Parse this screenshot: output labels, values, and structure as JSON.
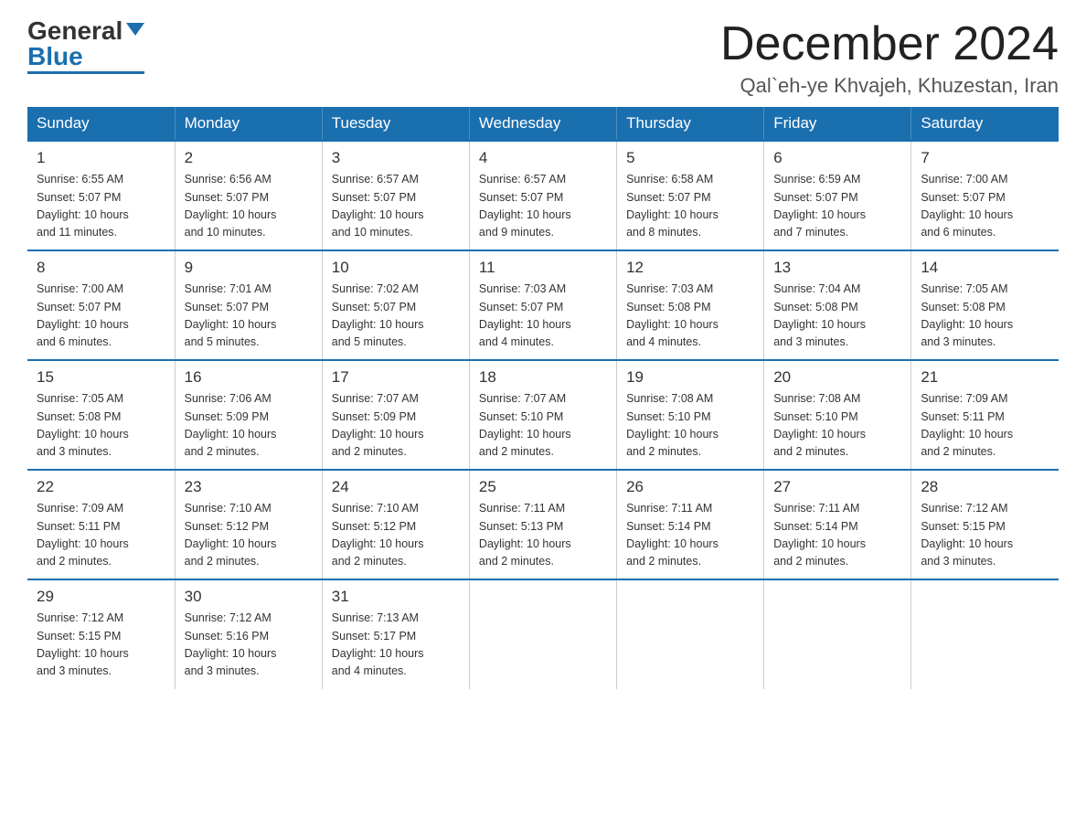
{
  "logo": {
    "general": "General",
    "blue": "Blue"
  },
  "header": {
    "month": "December 2024",
    "location": "Qal`eh-ye Khvajeh, Khuzestan, Iran"
  },
  "days_of_week": [
    "Sunday",
    "Monday",
    "Tuesday",
    "Wednesday",
    "Thursday",
    "Friday",
    "Saturday"
  ],
  "weeks": [
    [
      {
        "day": "1",
        "sunrise": "6:55 AM",
        "sunset": "5:07 PM",
        "daylight": "10 hours and 11 minutes."
      },
      {
        "day": "2",
        "sunrise": "6:56 AM",
        "sunset": "5:07 PM",
        "daylight": "10 hours and 10 minutes."
      },
      {
        "day": "3",
        "sunrise": "6:57 AM",
        "sunset": "5:07 PM",
        "daylight": "10 hours and 10 minutes."
      },
      {
        "day": "4",
        "sunrise": "6:57 AM",
        "sunset": "5:07 PM",
        "daylight": "10 hours and 9 minutes."
      },
      {
        "day": "5",
        "sunrise": "6:58 AM",
        "sunset": "5:07 PM",
        "daylight": "10 hours and 8 minutes."
      },
      {
        "day": "6",
        "sunrise": "6:59 AM",
        "sunset": "5:07 PM",
        "daylight": "10 hours and 7 minutes."
      },
      {
        "day": "7",
        "sunrise": "7:00 AM",
        "sunset": "5:07 PM",
        "daylight": "10 hours and 6 minutes."
      }
    ],
    [
      {
        "day": "8",
        "sunrise": "7:00 AM",
        "sunset": "5:07 PM",
        "daylight": "10 hours and 6 minutes."
      },
      {
        "day": "9",
        "sunrise": "7:01 AM",
        "sunset": "5:07 PM",
        "daylight": "10 hours and 5 minutes."
      },
      {
        "day": "10",
        "sunrise": "7:02 AM",
        "sunset": "5:07 PM",
        "daylight": "10 hours and 5 minutes."
      },
      {
        "day": "11",
        "sunrise": "7:03 AM",
        "sunset": "5:07 PM",
        "daylight": "10 hours and 4 minutes."
      },
      {
        "day": "12",
        "sunrise": "7:03 AM",
        "sunset": "5:08 PM",
        "daylight": "10 hours and 4 minutes."
      },
      {
        "day": "13",
        "sunrise": "7:04 AM",
        "sunset": "5:08 PM",
        "daylight": "10 hours and 3 minutes."
      },
      {
        "day": "14",
        "sunrise": "7:05 AM",
        "sunset": "5:08 PM",
        "daylight": "10 hours and 3 minutes."
      }
    ],
    [
      {
        "day": "15",
        "sunrise": "7:05 AM",
        "sunset": "5:08 PM",
        "daylight": "10 hours and 3 minutes."
      },
      {
        "day": "16",
        "sunrise": "7:06 AM",
        "sunset": "5:09 PM",
        "daylight": "10 hours and 2 minutes."
      },
      {
        "day": "17",
        "sunrise": "7:07 AM",
        "sunset": "5:09 PM",
        "daylight": "10 hours and 2 minutes."
      },
      {
        "day": "18",
        "sunrise": "7:07 AM",
        "sunset": "5:10 PM",
        "daylight": "10 hours and 2 minutes."
      },
      {
        "day": "19",
        "sunrise": "7:08 AM",
        "sunset": "5:10 PM",
        "daylight": "10 hours and 2 minutes."
      },
      {
        "day": "20",
        "sunrise": "7:08 AM",
        "sunset": "5:10 PM",
        "daylight": "10 hours and 2 minutes."
      },
      {
        "day": "21",
        "sunrise": "7:09 AM",
        "sunset": "5:11 PM",
        "daylight": "10 hours and 2 minutes."
      }
    ],
    [
      {
        "day": "22",
        "sunrise": "7:09 AM",
        "sunset": "5:11 PM",
        "daylight": "10 hours and 2 minutes."
      },
      {
        "day": "23",
        "sunrise": "7:10 AM",
        "sunset": "5:12 PM",
        "daylight": "10 hours and 2 minutes."
      },
      {
        "day": "24",
        "sunrise": "7:10 AM",
        "sunset": "5:12 PM",
        "daylight": "10 hours and 2 minutes."
      },
      {
        "day": "25",
        "sunrise": "7:11 AM",
        "sunset": "5:13 PM",
        "daylight": "10 hours and 2 minutes."
      },
      {
        "day": "26",
        "sunrise": "7:11 AM",
        "sunset": "5:14 PM",
        "daylight": "10 hours and 2 minutes."
      },
      {
        "day": "27",
        "sunrise": "7:11 AM",
        "sunset": "5:14 PM",
        "daylight": "10 hours and 2 minutes."
      },
      {
        "day": "28",
        "sunrise": "7:12 AM",
        "sunset": "5:15 PM",
        "daylight": "10 hours and 3 minutes."
      }
    ],
    [
      {
        "day": "29",
        "sunrise": "7:12 AM",
        "sunset": "5:15 PM",
        "daylight": "10 hours and 3 minutes."
      },
      {
        "day": "30",
        "sunrise": "7:12 AM",
        "sunset": "5:16 PM",
        "daylight": "10 hours and 3 minutes."
      },
      {
        "day": "31",
        "sunrise": "7:13 AM",
        "sunset": "5:17 PM",
        "daylight": "10 hours and 4 minutes."
      },
      null,
      null,
      null,
      null
    ]
  ],
  "labels": {
    "sunrise": "Sunrise:",
    "sunset": "Sunset:",
    "daylight": "Daylight:"
  }
}
